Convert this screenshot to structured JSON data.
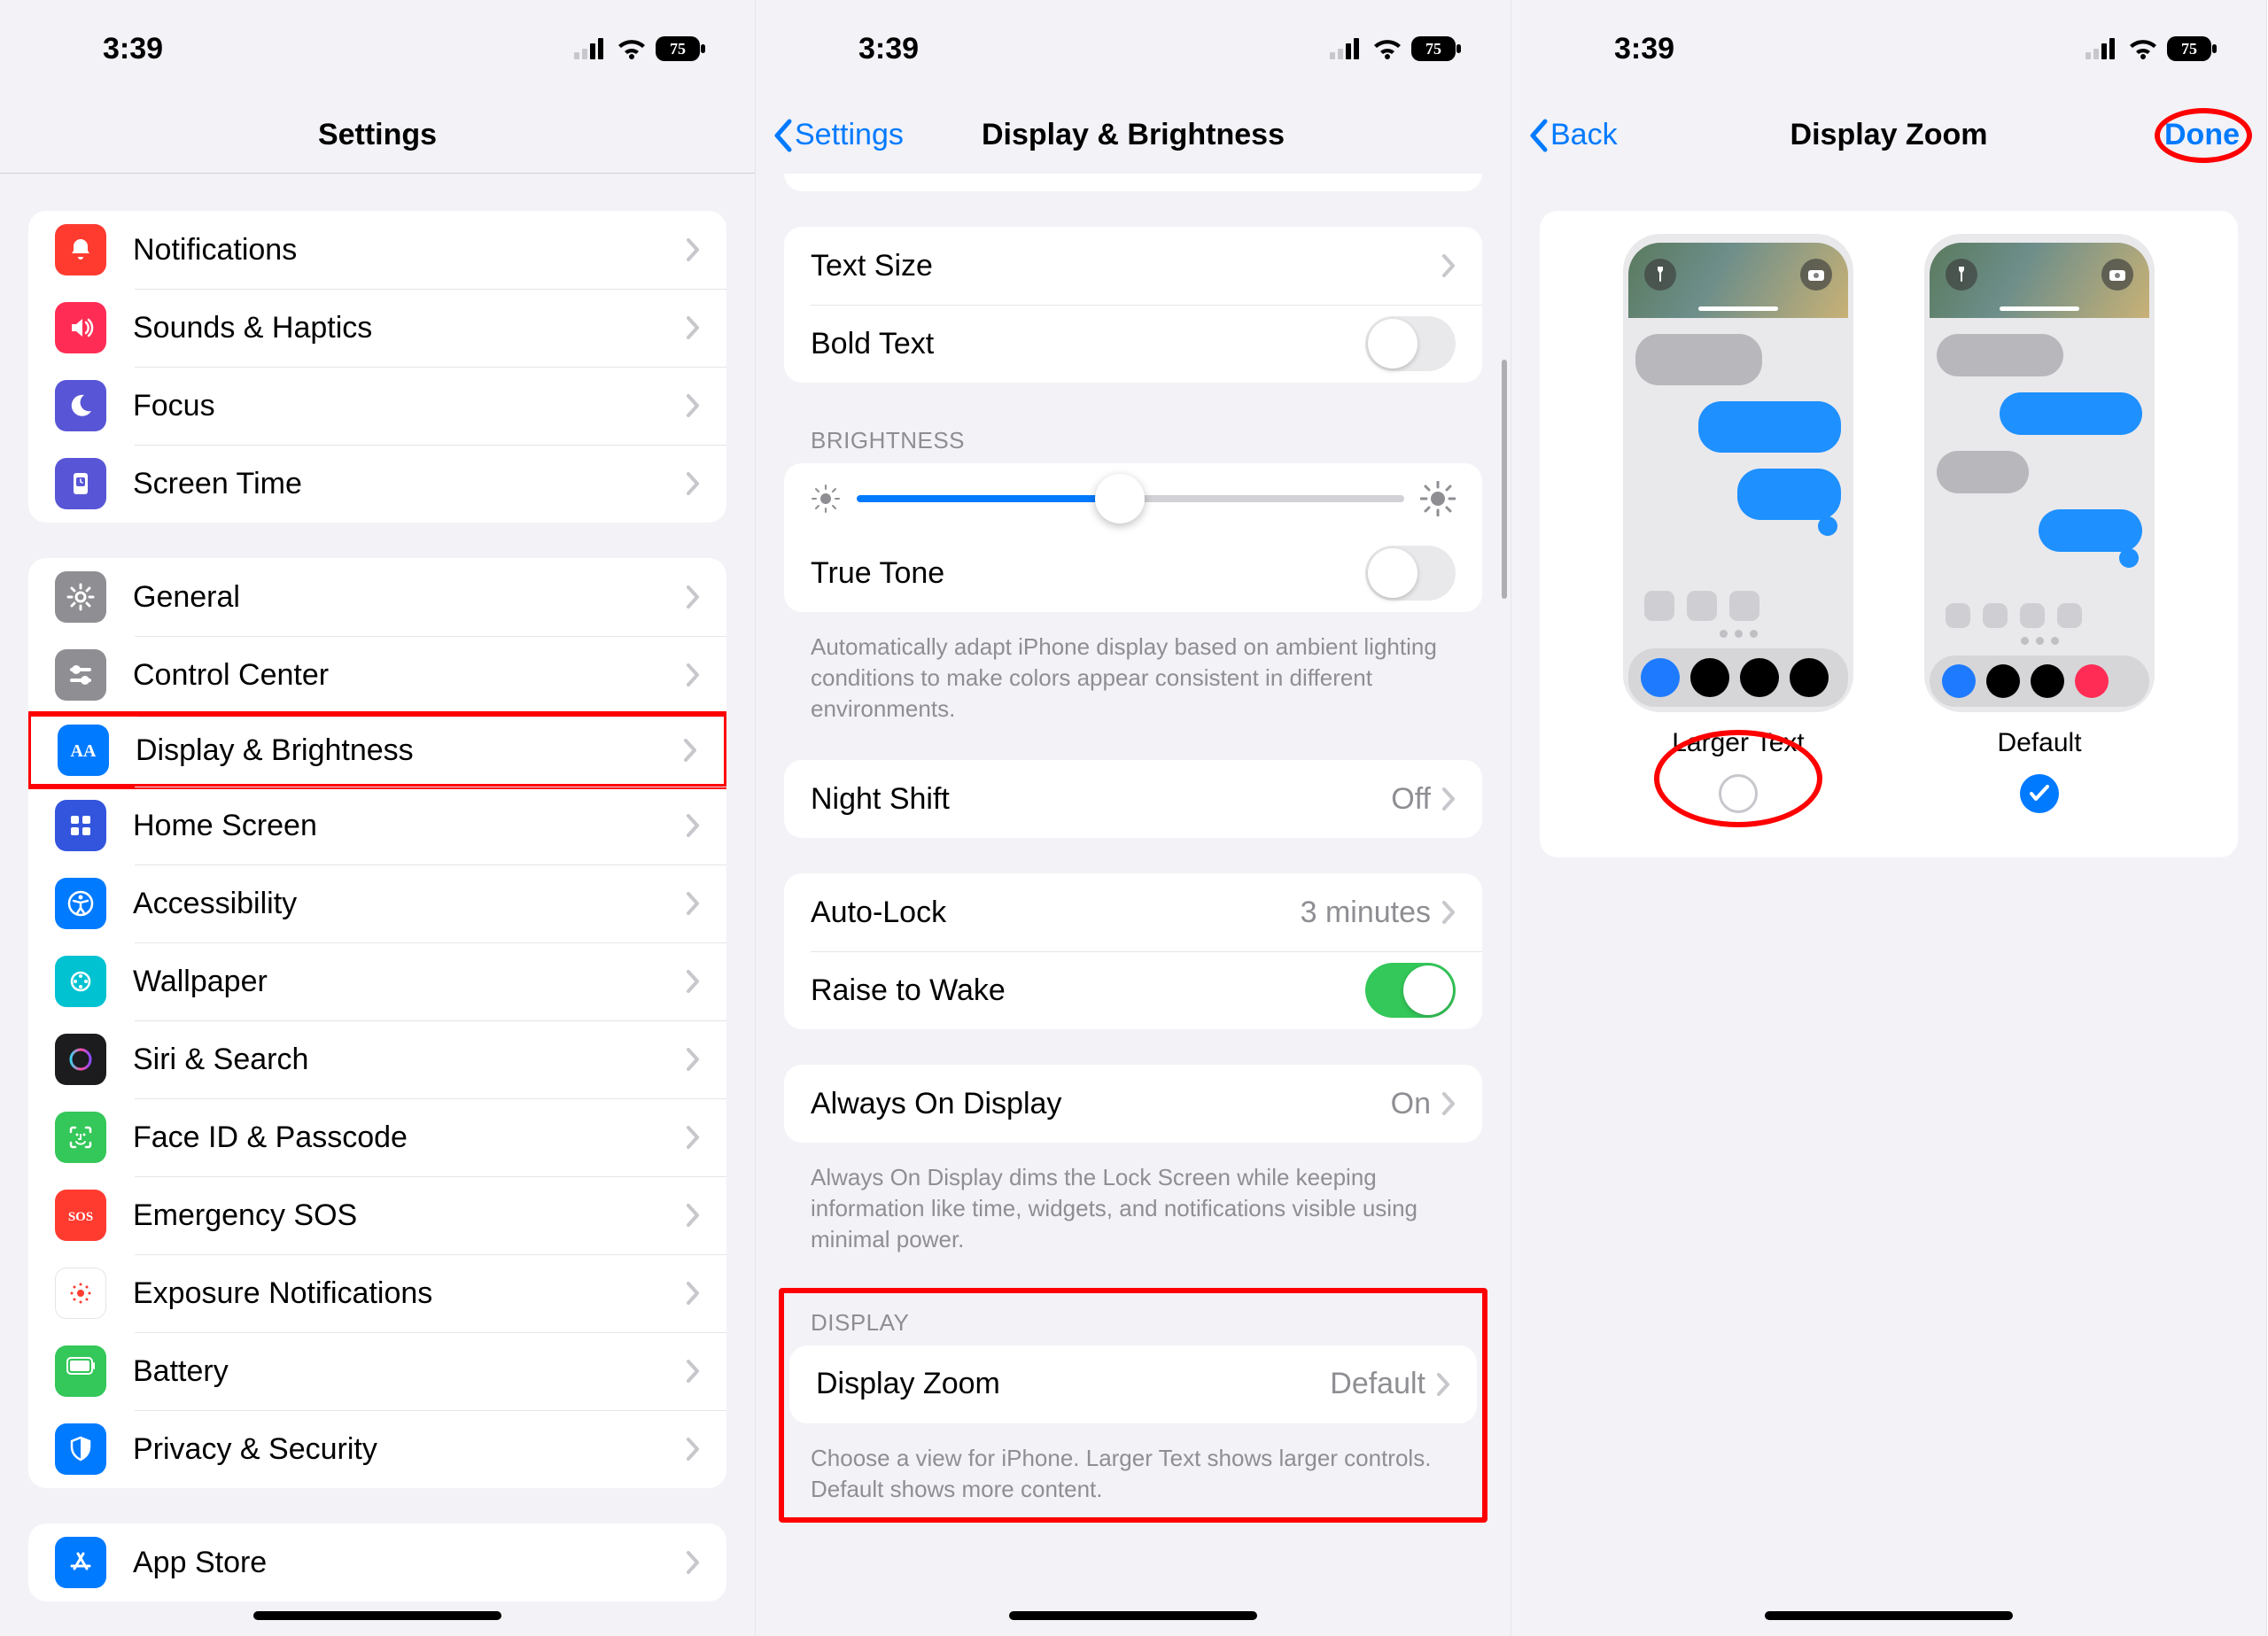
{
  "status": {
    "time": "3:39",
    "battery": "75"
  },
  "screen1": {
    "title": "Settings",
    "group1": [
      {
        "id": "notifications",
        "label": "Notifications",
        "icon_bg": "#ff3b30"
      },
      {
        "id": "sounds",
        "label": "Sounds & Haptics",
        "icon_bg": "#ff2d55"
      },
      {
        "id": "focus",
        "label": "Focus",
        "icon_bg": "#5856d6"
      },
      {
        "id": "screentime",
        "label": "Screen Time",
        "icon_bg": "#5856d6"
      }
    ],
    "group2": [
      {
        "id": "general",
        "label": "General",
        "icon_bg": "#8e8e93"
      },
      {
        "id": "controlcenter",
        "label": "Control Center",
        "icon_bg": "#8e8e93"
      },
      {
        "id": "display",
        "label": "Display & Brightness",
        "icon_bg": "#007aff",
        "highlight": true
      },
      {
        "id": "homescreen",
        "label": "Home Screen",
        "icon_bg": "#3355dd"
      },
      {
        "id": "accessibility",
        "label": "Accessibility",
        "icon_bg": "#007aff"
      },
      {
        "id": "wallpaper",
        "label": "Wallpaper",
        "icon_bg": "#00c2d1"
      },
      {
        "id": "siri",
        "label": "Siri & Search",
        "icon_bg": "#1c1c1e"
      },
      {
        "id": "faceid",
        "label": "Face ID & Passcode",
        "icon_bg": "#34c759"
      },
      {
        "id": "sos",
        "label": "Emergency SOS",
        "icon_bg": "#ff3b30"
      },
      {
        "id": "exposure",
        "label": "Exposure Notifications",
        "icon_bg": "#ffffff"
      },
      {
        "id": "battery",
        "label": "Battery",
        "icon_bg": "#34c759"
      },
      {
        "id": "privacy",
        "label": "Privacy & Security",
        "icon_bg": "#007aff"
      }
    ],
    "group3": [
      {
        "id": "appstore",
        "label": "App Store",
        "icon_bg": "#007aff"
      }
    ]
  },
  "screen2": {
    "back": "Settings",
    "title": "Display & Brightness",
    "text_size_label": "Text Size",
    "bold_text_label": "Bold Text",
    "brightness_header": "BRIGHTNESS",
    "true_tone_label": "True Tone",
    "true_tone_footer": "Automatically adapt iPhone display based on ambient lighting conditions to make colors appear consistent in different environments.",
    "night_shift_label": "Night Shift",
    "night_shift_value": "Off",
    "auto_lock_label": "Auto-Lock",
    "auto_lock_value": "3 minutes",
    "raise_to_wake_label": "Raise to Wake",
    "always_on_label": "Always On Display",
    "always_on_value": "On",
    "always_on_footer": "Always On Display dims the Lock Screen while keeping information like time, widgets, and notifications visible using minimal power.",
    "display_header": "DISPLAY",
    "display_zoom_label": "Display Zoom",
    "display_zoom_value": "Default",
    "display_zoom_footer": "Choose a view for iPhone. Larger Text shows larger controls. Default shows more content."
  },
  "screen3": {
    "back": "Back",
    "title": "Display Zoom",
    "done": "Done",
    "option_larger": "Larger Text",
    "option_default": "Default"
  }
}
